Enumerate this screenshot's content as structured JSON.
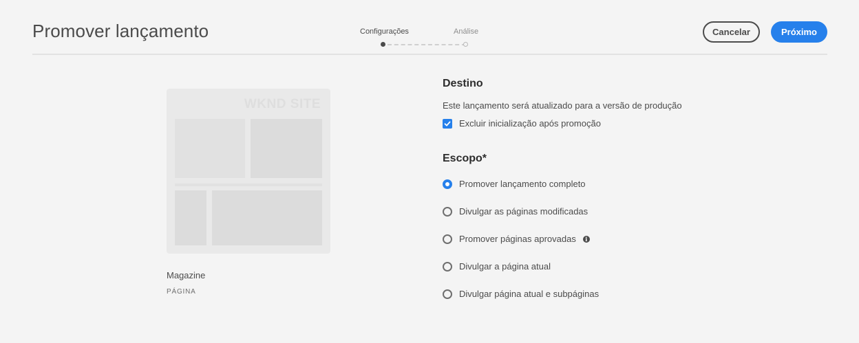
{
  "header": {
    "title": "Promover lançamento",
    "steps": [
      {
        "label": "Configurações",
        "active": true
      },
      {
        "label": "Análise",
        "active": false
      }
    ],
    "cancel_label": "Cancelar",
    "next_label": "Próximo"
  },
  "preview": {
    "thumbnail_text": "WKND SITE",
    "name": "Magazine",
    "type": "PÁGINA"
  },
  "destination": {
    "heading": "Destino",
    "description": "Este lançamento será atualizado para a versão de produção",
    "checkbox_label": "Excluir inicialização após promoção",
    "checkbox_checked": true
  },
  "scope": {
    "heading": "Escopo*",
    "options": [
      {
        "label": "Promover lançamento completo",
        "checked": true
      },
      {
        "label": "Divulgar as páginas modificadas",
        "checked": false
      },
      {
        "label": "Promover páginas aprovadas",
        "checked": false,
        "icon": "info-icon"
      },
      {
        "label": "Divulgar a página atual",
        "checked": false
      },
      {
        "label": "Divulgar página atual e subpáginas",
        "checked": false
      }
    ]
  },
  "colors": {
    "accent": "#2680eb",
    "text": "#4b4b4b",
    "background": "#f4f4f4"
  }
}
